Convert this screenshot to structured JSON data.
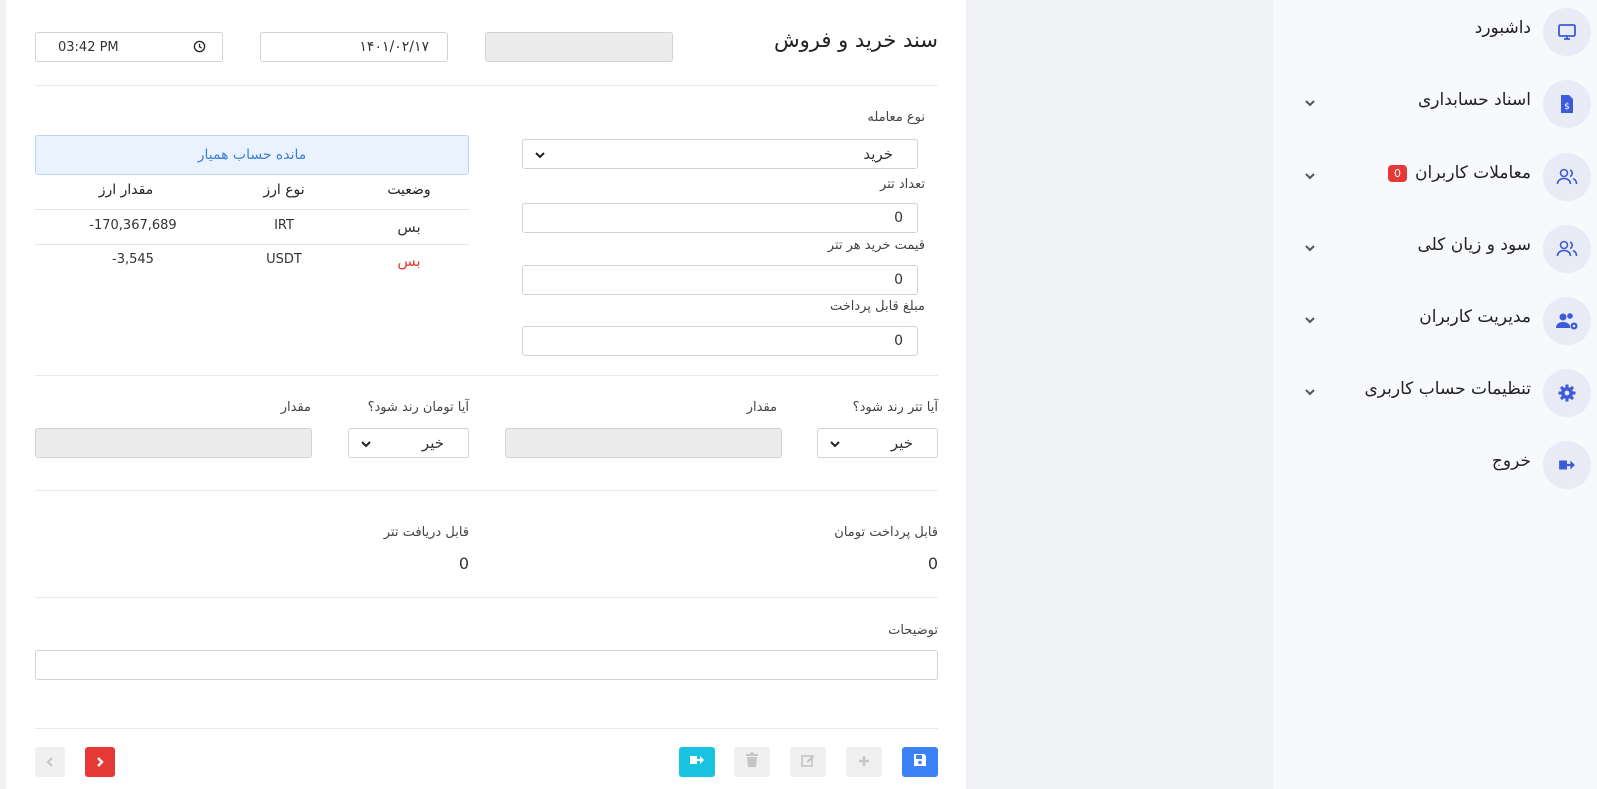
{
  "sidebar": {
    "items": [
      {
        "label": "داشبورد",
        "icon": "monitor-icon",
        "has_chevron": false
      },
      {
        "label": "اسناد حسابداری",
        "icon": "document-dollar-icon",
        "has_chevron": true
      },
      {
        "label": "معاملات کاربران",
        "icon": "users-icon",
        "has_chevron": true,
        "badge": "0"
      },
      {
        "label": "سود و زیان کلی",
        "icon": "users-icon",
        "has_chevron": true
      },
      {
        "label": "مدیریت کاربران",
        "icon": "users-gear-icon",
        "has_chevron": true
      },
      {
        "label": "تنظیمات حساب کاربری",
        "icon": "gear-icon",
        "has_chevron": true
      },
      {
        "label": "خروج",
        "icon": "logout-icon",
        "has_chevron": false
      }
    ]
  },
  "header": {
    "title": "سند خرید و فروش",
    "time_value": "03:42  PM",
    "date_value": "۱۴۰۱/۰۲/۱۷",
    "doc_number_value": ""
  },
  "form": {
    "trade_type": {
      "label": "نوع معامله",
      "value": "خرید"
    },
    "tether_count": {
      "label": "تعداد تتر",
      "value": "0"
    },
    "unit_price": {
      "label": "قیمت خرید هر تتر",
      "value": "0"
    },
    "payable_amount": {
      "label": "مبلغ قابل پرداخت",
      "value": "0"
    },
    "round_tether": {
      "label": "آیا تتر رند شود؟",
      "value": "خیر"
    },
    "round_tether_amount": {
      "label": "مقدار",
      "value": ""
    },
    "round_toman": {
      "label": "آیا تومان رند شود؟",
      "value": "خیر"
    },
    "round_toman_amount": {
      "label": "مقدار",
      "value": ""
    },
    "toman_payable": {
      "label": "قابل پرداخت تومان",
      "value": "0"
    },
    "tether_receivable": {
      "label": "قابل دریافت تتر",
      "value": "0"
    },
    "notes": {
      "label": "توضیحات",
      "value": ""
    }
  },
  "balance": {
    "title": "مانده حساب همیار",
    "headers": {
      "status": "وضعیت",
      "currency": "نوع ارز",
      "amount": "مقدار ارز"
    },
    "rows": [
      {
        "status": "بس",
        "currency": "IRT",
        "amount": "-170,367,689",
        "status_color": "#333333"
      },
      {
        "status": "بس",
        "currency": "USDT",
        "amount": "-3,545",
        "status_color": "#e53935"
      }
    ]
  },
  "toolbar": {
    "buttons": [
      {
        "name": "save-button",
        "icon": "save-icon",
        "color": "#3b82f6"
      },
      {
        "name": "add-button",
        "icon": "plus-icon",
        "color": "#f0f0f0"
      },
      {
        "name": "edit-button",
        "icon": "edit-icon",
        "color": "#f0f0f0"
      },
      {
        "name": "delete-button",
        "icon": "trash-icon",
        "color": "#f0f0f0"
      },
      {
        "name": "exit-button",
        "icon": "logout-icon",
        "color": "#17c3e0"
      },
      {
        "name": "next-button",
        "icon": "chevron-right-icon",
        "color": "#e53935"
      },
      {
        "name": "prev-button",
        "icon": "chevron-left-icon",
        "color": "#f0f0f0"
      }
    ]
  },
  "colors": {
    "accent": "#3b5bdb",
    "danger": "#e53935",
    "info": "#17c3e0",
    "primary": "#3b82f6"
  }
}
